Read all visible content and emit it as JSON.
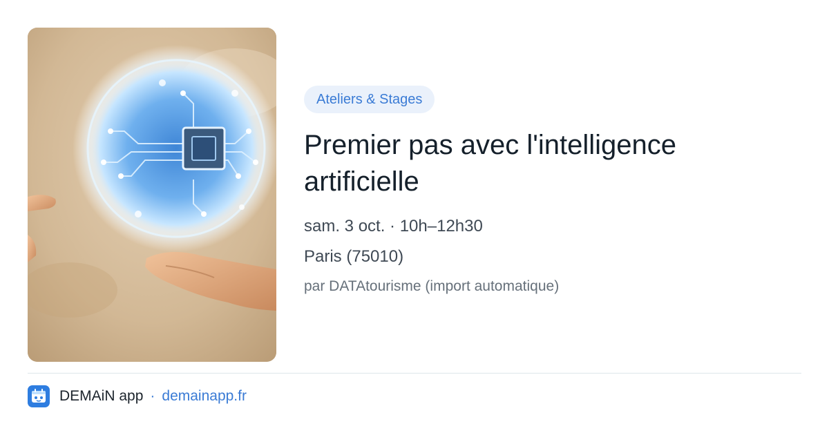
{
  "event": {
    "category": "Ateliers & Stages",
    "title": "Premier pas avec l'intelligence artificielle",
    "date_time": "sam. 3 oct. · 10h–12h30",
    "location": "Paris (75010)",
    "source": "par DATAtourisme (import automatique)"
  },
  "footer": {
    "app_name": "DEMAiN app",
    "separator": "·",
    "domain": "demainapp.fr",
    "logo_icon": "demain-app-logo-icon"
  },
  "colors": {
    "accent": "#3a7bd5",
    "tag_background": "#eaf1fb",
    "title": "#15202b",
    "muted": "#66707a"
  }
}
